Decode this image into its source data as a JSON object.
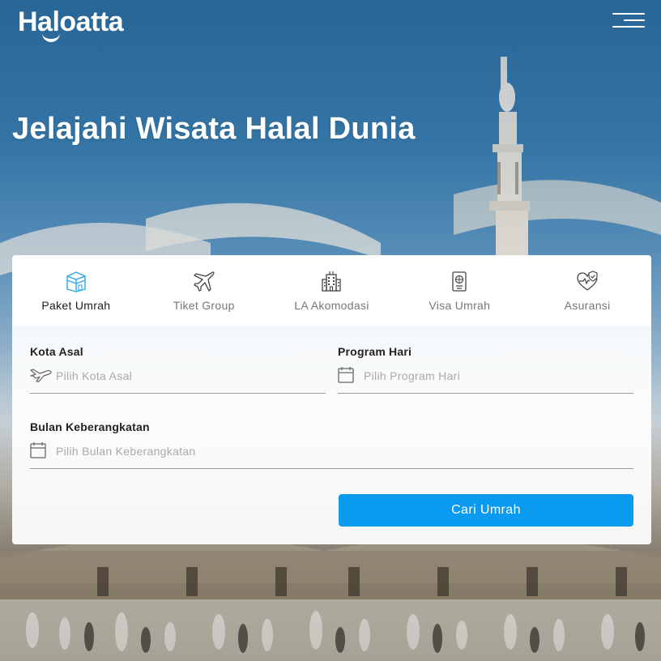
{
  "header": {
    "logo_text": "Haloatta",
    "menu_icon": "hamburger-menu-icon"
  },
  "hero": {
    "title": "Jelajahi Wisata Halal Dunia"
  },
  "tabs": [
    {
      "label": "Paket Umrah",
      "icon": "kaaba-icon",
      "active": true
    },
    {
      "label": "Tiket Group",
      "icon": "airplane-icon",
      "active": false
    },
    {
      "label": "LA Akomodasi",
      "icon": "hotel-building-icon",
      "active": false
    },
    {
      "label": "Visa Umrah",
      "icon": "passport-icon",
      "active": false
    },
    {
      "label": "Asuransi",
      "icon": "health-shield-icon",
      "active": false
    }
  ],
  "form": {
    "origin": {
      "label": "Kota Asal",
      "placeholder": "Pilih Kota Asal",
      "value": "",
      "icon": "airplane-icon"
    },
    "program": {
      "label": "Program Hari",
      "placeholder": "Pilih Program Hari",
      "value": "",
      "icon": "calendar-icon"
    },
    "month": {
      "label": "Bulan Keberangkatan",
      "placeholder": "Pilih Bulan Keberangkatan",
      "value": "",
      "icon": "calendar-icon"
    },
    "submit_label": "Cari Umrah"
  },
  "colors": {
    "accent": "#0a9bf0",
    "active_icon": "#2aa8e8",
    "inactive_icon": "#555555"
  }
}
